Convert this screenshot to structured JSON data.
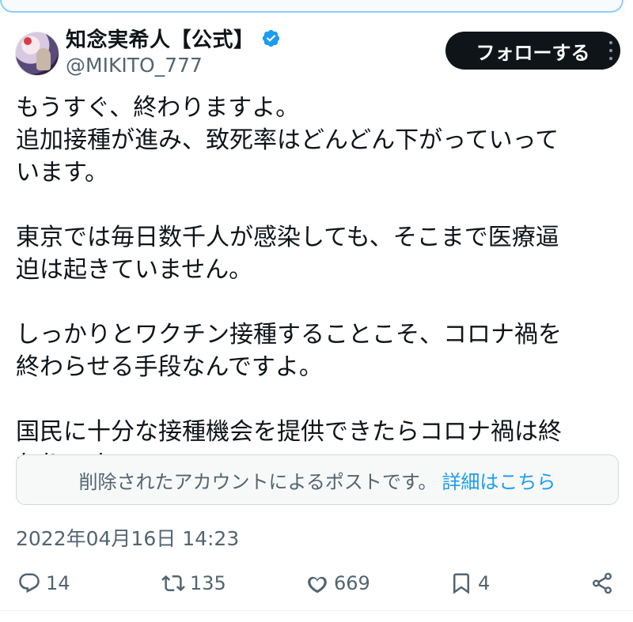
{
  "author": {
    "display_name": "知念実希人【公式】",
    "handle": "@MIKITO_777",
    "verified": true
  },
  "follow_button": {
    "label": "フォローする"
  },
  "tweet": {
    "paragraphs": [
      [
        "もうすぐ、終わりますよ。",
        "追加接種が進み、致死率はどんどん下がっていって",
        "います。"
      ],
      [
        "東京では毎日数千人が感染しても、そこまで医療逼",
        "迫は起きていません。"
      ],
      [
        "しっかりとワクチン接種することこそ、コロナ禍を",
        "終わらせる手段なんですよ。"
      ],
      [
        "国民に十分な接種機会を提供できたらコロナ禍は終",
        "わりです。"
      ]
    ]
  },
  "notice": {
    "text": "削除されたアカウントによるポストです。",
    "link_label": "詳細はこちら"
  },
  "timestamp": "2022年04月16日 14:23",
  "metrics": {
    "replies": "14",
    "reposts": "135",
    "likes": "669",
    "bookmarks": "4"
  },
  "icons": {
    "verified": "verified-badge-icon",
    "more": "more-options-icon",
    "reply": "reply-icon",
    "repost": "repost-icon",
    "like": "heart-icon",
    "bookmark": "bookmark-icon",
    "share": "share-icon"
  },
  "colors": {
    "verified_blue": "#1d9bf0",
    "link_blue": "#1d9bf0",
    "follow_bg": "#0f1419",
    "muted_text": "#536471"
  }
}
